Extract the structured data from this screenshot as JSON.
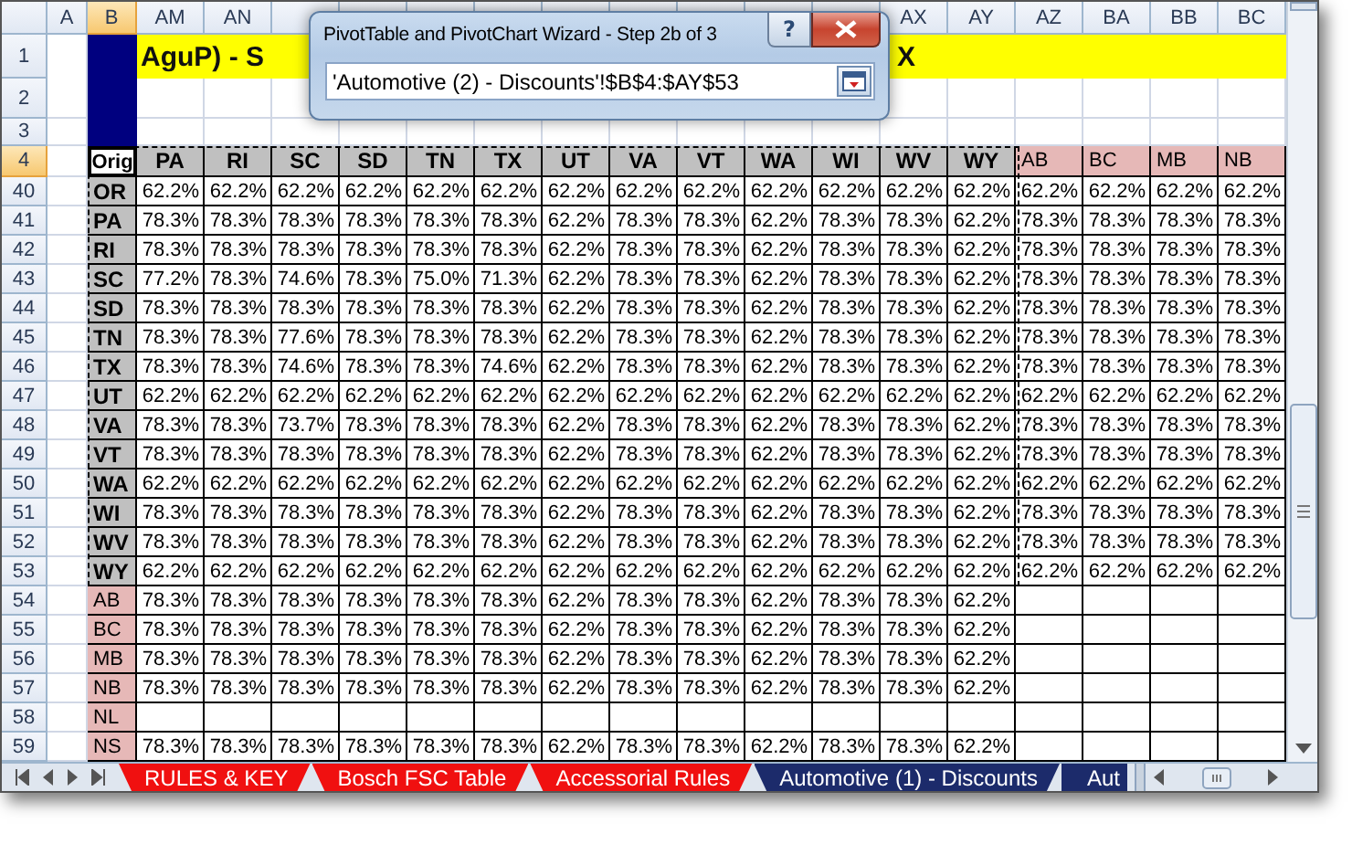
{
  "column_headers": [
    {
      "label": "A",
      "selected": false
    },
    {
      "label": "B",
      "selected": true
    },
    {
      "label": "AM",
      "selected": false
    },
    {
      "label": "AN",
      "selected": false
    }
  ],
  "column_headers_right": [
    {
      "label": "AX",
      "selected": false
    },
    {
      "label": "AY",
      "selected": false
    },
    {
      "label": "AZ",
      "selected": false
    },
    {
      "label": "BA",
      "selected": false
    },
    {
      "label": "BB",
      "selected": false
    },
    {
      "label": "BC",
      "selected": false
    }
  ],
  "title_row": {
    "number": "1",
    "selected": false,
    "title": "AguP) - S",
    "title_end": "X"
  },
  "blank_rows": [
    {
      "number": "2",
      "selected": false
    },
    {
      "number": "3",
      "selected": false
    }
  ],
  "field_row": {
    "number": "4",
    "selected": true,
    "corner": "Orig",
    "fields": [
      {
        "label": "PA",
        "kind": "pivot"
      },
      {
        "label": "RI",
        "kind": "pivot"
      },
      {
        "label": "SC",
        "kind": "pivot"
      },
      {
        "label": "SD",
        "kind": "pivot"
      },
      {
        "label": "TN",
        "kind": "pivot"
      },
      {
        "label": "TX",
        "kind": "pivot"
      },
      {
        "label": "UT",
        "kind": "pivot"
      },
      {
        "label": "VA",
        "kind": "pivot"
      },
      {
        "label": "VT",
        "kind": "pivot"
      },
      {
        "label": "WA",
        "kind": "pivot"
      },
      {
        "label": "WI",
        "kind": "pivot"
      },
      {
        "label": "WV",
        "kind": "pivot"
      },
      {
        "label": "WY",
        "kind": "pivot"
      },
      {
        "label": "AB",
        "kind": "other"
      },
      {
        "label": "BC",
        "kind": "other"
      },
      {
        "label": "MB",
        "kind": "other"
      },
      {
        "label": "NB",
        "kind": "other"
      }
    ]
  },
  "rows": [
    {
      "number": "40",
      "selected": false,
      "kind": "pivot",
      "label": "OR",
      "values": [
        "62.2%",
        "62.2%",
        "62.2%",
        "62.2%",
        "62.2%",
        "62.2%",
        "62.2%",
        "62.2%",
        "62.2%",
        "62.2%",
        "62.2%",
        "62.2%",
        "62.2%",
        "62.2%",
        "62.2%",
        "62.2%",
        "62.2%"
      ]
    },
    {
      "number": "41",
      "selected": false,
      "kind": "pivot",
      "label": "PA",
      "values": [
        "78.3%",
        "78.3%",
        "78.3%",
        "78.3%",
        "78.3%",
        "78.3%",
        "62.2%",
        "78.3%",
        "78.3%",
        "62.2%",
        "78.3%",
        "78.3%",
        "62.2%",
        "78.3%",
        "78.3%",
        "78.3%",
        "78.3%"
      ]
    },
    {
      "number": "42",
      "selected": false,
      "kind": "pivot",
      "label": "RI",
      "values": [
        "78.3%",
        "78.3%",
        "78.3%",
        "78.3%",
        "78.3%",
        "78.3%",
        "62.2%",
        "78.3%",
        "78.3%",
        "62.2%",
        "78.3%",
        "78.3%",
        "62.2%",
        "78.3%",
        "78.3%",
        "78.3%",
        "78.3%"
      ]
    },
    {
      "number": "43",
      "selected": false,
      "kind": "pivot",
      "label": "SC",
      "values": [
        "77.2%",
        "78.3%",
        "74.6%",
        "78.3%",
        "75.0%",
        "71.3%",
        "62.2%",
        "78.3%",
        "78.3%",
        "62.2%",
        "78.3%",
        "78.3%",
        "62.2%",
        "78.3%",
        "78.3%",
        "78.3%",
        "78.3%"
      ]
    },
    {
      "number": "44",
      "selected": false,
      "kind": "pivot",
      "label": "SD",
      "values": [
        "78.3%",
        "78.3%",
        "78.3%",
        "78.3%",
        "78.3%",
        "78.3%",
        "62.2%",
        "78.3%",
        "78.3%",
        "62.2%",
        "78.3%",
        "78.3%",
        "62.2%",
        "78.3%",
        "78.3%",
        "78.3%",
        "78.3%"
      ]
    },
    {
      "number": "45",
      "selected": false,
      "kind": "pivot",
      "label": "TN",
      "values": [
        "78.3%",
        "78.3%",
        "77.6%",
        "78.3%",
        "78.3%",
        "78.3%",
        "62.2%",
        "78.3%",
        "78.3%",
        "62.2%",
        "78.3%",
        "78.3%",
        "62.2%",
        "78.3%",
        "78.3%",
        "78.3%",
        "78.3%"
      ]
    },
    {
      "number": "46",
      "selected": false,
      "kind": "pivot",
      "label": "TX",
      "values": [
        "78.3%",
        "78.3%",
        "74.6%",
        "78.3%",
        "78.3%",
        "74.6%",
        "62.2%",
        "78.3%",
        "78.3%",
        "62.2%",
        "78.3%",
        "78.3%",
        "62.2%",
        "78.3%",
        "78.3%",
        "78.3%",
        "78.3%"
      ]
    },
    {
      "number": "47",
      "selected": false,
      "kind": "pivot",
      "label": "UT",
      "values": [
        "62.2%",
        "62.2%",
        "62.2%",
        "62.2%",
        "62.2%",
        "62.2%",
        "62.2%",
        "62.2%",
        "62.2%",
        "62.2%",
        "62.2%",
        "62.2%",
        "62.2%",
        "62.2%",
        "62.2%",
        "62.2%",
        "62.2%"
      ]
    },
    {
      "number": "48",
      "selected": false,
      "kind": "pivot",
      "label": "VA",
      "values": [
        "78.3%",
        "78.3%",
        "73.7%",
        "78.3%",
        "78.3%",
        "78.3%",
        "62.2%",
        "78.3%",
        "78.3%",
        "62.2%",
        "78.3%",
        "78.3%",
        "62.2%",
        "78.3%",
        "78.3%",
        "78.3%",
        "78.3%"
      ]
    },
    {
      "number": "49",
      "selected": false,
      "kind": "pivot",
      "label": "VT",
      "values": [
        "78.3%",
        "78.3%",
        "78.3%",
        "78.3%",
        "78.3%",
        "78.3%",
        "62.2%",
        "78.3%",
        "78.3%",
        "62.2%",
        "78.3%",
        "78.3%",
        "62.2%",
        "78.3%",
        "78.3%",
        "78.3%",
        "78.3%"
      ]
    },
    {
      "number": "50",
      "selected": false,
      "kind": "pivot",
      "label": "WA",
      "values": [
        "62.2%",
        "62.2%",
        "62.2%",
        "62.2%",
        "62.2%",
        "62.2%",
        "62.2%",
        "62.2%",
        "62.2%",
        "62.2%",
        "62.2%",
        "62.2%",
        "62.2%",
        "62.2%",
        "62.2%",
        "62.2%",
        "62.2%"
      ]
    },
    {
      "number": "51",
      "selected": false,
      "kind": "pivot",
      "label": "WI",
      "values": [
        "78.3%",
        "78.3%",
        "78.3%",
        "78.3%",
        "78.3%",
        "78.3%",
        "62.2%",
        "78.3%",
        "78.3%",
        "62.2%",
        "78.3%",
        "78.3%",
        "62.2%",
        "78.3%",
        "78.3%",
        "78.3%",
        "78.3%"
      ]
    },
    {
      "number": "52",
      "selected": false,
      "kind": "pivot",
      "label": "WV",
      "values": [
        "78.3%",
        "78.3%",
        "78.3%",
        "78.3%",
        "78.3%",
        "78.3%",
        "62.2%",
        "78.3%",
        "78.3%",
        "62.2%",
        "78.3%",
        "78.3%",
        "62.2%",
        "78.3%",
        "78.3%",
        "78.3%",
        "78.3%"
      ]
    },
    {
      "number": "53",
      "selected": false,
      "kind": "pivot",
      "label": "WY",
      "values": [
        "62.2%",
        "62.2%",
        "62.2%",
        "62.2%",
        "62.2%",
        "62.2%",
        "62.2%",
        "62.2%",
        "62.2%",
        "62.2%",
        "62.2%",
        "62.2%",
        "62.2%",
        "62.2%",
        "62.2%",
        "62.2%",
        "62.2%"
      ]
    },
    {
      "number": "54",
      "selected": false,
      "kind": "other",
      "label": "AB",
      "values": [
        "78.3%",
        "78.3%",
        "78.3%",
        "78.3%",
        "78.3%",
        "78.3%",
        "62.2%",
        "78.3%",
        "78.3%",
        "62.2%",
        "78.3%",
        "78.3%",
        "62.2%"
      ]
    },
    {
      "number": "55",
      "selected": false,
      "kind": "other",
      "label": "BC",
      "values": [
        "78.3%",
        "78.3%",
        "78.3%",
        "78.3%",
        "78.3%",
        "78.3%",
        "62.2%",
        "78.3%",
        "78.3%",
        "62.2%",
        "78.3%",
        "78.3%",
        "62.2%"
      ]
    },
    {
      "number": "56",
      "selected": false,
      "kind": "other",
      "label": "MB",
      "values": [
        "78.3%",
        "78.3%",
        "78.3%",
        "78.3%",
        "78.3%",
        "78.3%",
        "62.2%",
        "78.3%",
        "78.3%",
        "62.2%",
        "78.3%",
        "78.3%",
        "62.2%"
      ]
    },
    {
      "number": "57",
      "selected": false,
      "kind": "other",
      "label": "NB",
      "values": [
        "78.3%",
        "78.3%",
        "78.3%",
        "78.3%",
        "78.3%",
        "78.3%",
        "62.2%",
        "78.3%",
        "78.3%",
        "62.2%",
        "78.3%",
        "78.3%",
        "62.2%"
      ]
    },
    {
      "number": "58",
      "selected": false,
      "kind": "other",
      "label": "NL"
    },
    {
      "number": "59",
      "selected": false,
      "kind": "other",
      "label": "NS",
      "values": [
        "78.3%",
        "78.3%",
        "78.3%",
        "78.3%",
        "78.3%",
        "78.3%",
        "62.2%",
        "78.3%",
        "78.3%",
        "62.2%",
        "78.3%",
        "78.3%",
        "62.2%"
      ]
    }
  ],
  "dialog": {
    "title": "PivotTable and PivotChart Wizard - Step 2b of 3",
    "help": "?",
    "input_value": "'Automotive (2) - Discounts'!$B$4:$AY$53"
  },
  "sheet_tabs": [
    {
      "label": "RULES & KEY",
      "color": "#f01010",
      "selected": false
    },
    {
      "label": "Bosch FSC Table",
      "color": "#f01010",
      "selected": false
    },
    {
      "label": "Accessorial Rules",
      "color": "#f01010",
      "selected": false
    },
    {
      "label": "Automotive (1) - Discounts",
      "color": "#1c2b6b",
      "selected": false
    },
    {
      "label": "Aut",
      "color": "#1c2b6b",
      "selected": false
    }
  ]
}
